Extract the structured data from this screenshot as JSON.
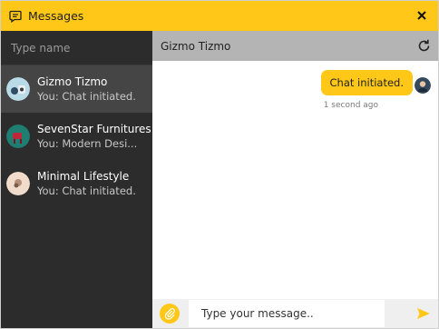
{
  "window": {
    "title": "Messages",
    "title_icon": "message-square-icon",
    "close_icon": "close-icon"
  },
  "sidebar": {
    "search_placeholder": "Type name",
    "conversations": [
      {
        "name": "Gizmo Tizmo",
        "preview": "You: Chat initiated.",
        "active": true
      },
      {
        "name": "SevenStar Furnitures",
        "preview": "You: Modern Desi...",
        "active": false
      },
      {
        "name": "Minimal Lifestyle",
        "preview": "You: Chat initiated.",
        "active": false
      }
    ]
  },
  "chat": {
    "title": "Gizmo Tizmo",
    "refresh_icon": "refresh-icon",
    "messages": [
      {
        "text": "Chat initiated.",
        "time": "1 second ago",
        "from": "you"
      }
    ],
    "input_placeholder": "Type your message..",
    "attach_icon": "paperclip-icon",
    "send_icon": "send-icon"
  },
  "colors": {
    "accent": "#ffc819",
    "sidebar_bg": "#2c2c2c",
    "sidebar_active": "#454545",
    "chat_header": "#b4b4b4",
    "composer_bg": "#efefef"
  }
}
